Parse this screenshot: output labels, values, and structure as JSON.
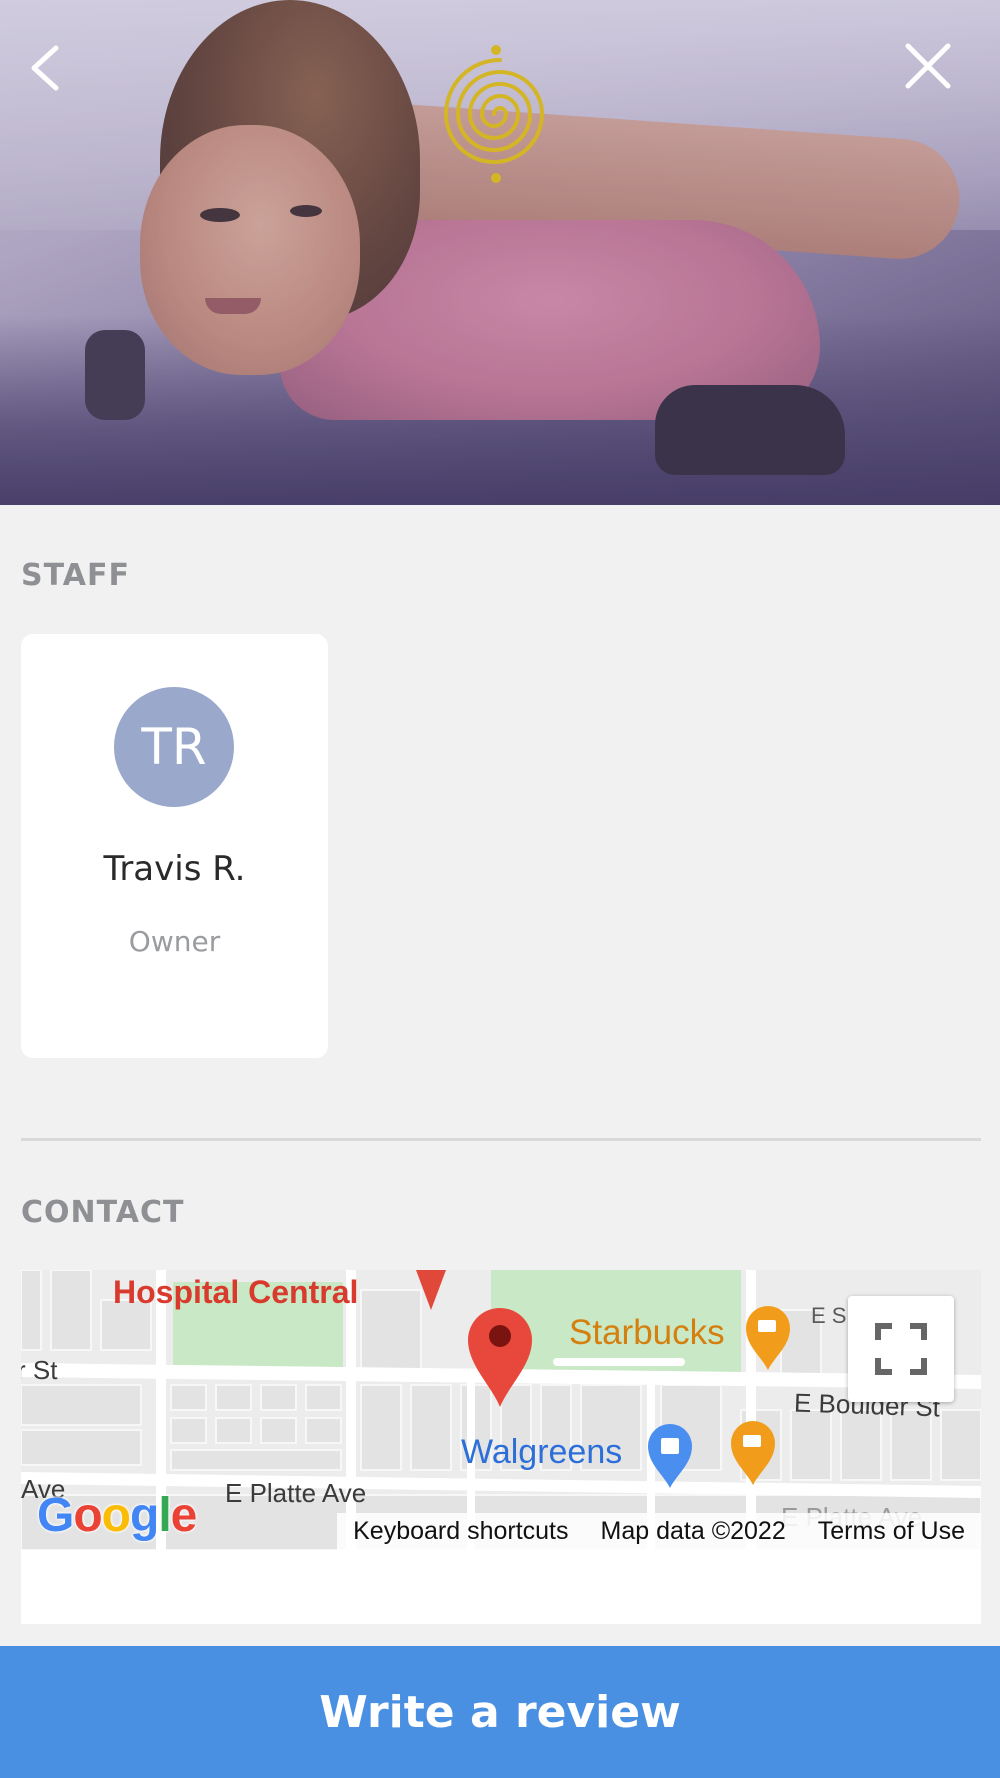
{
  "hero": {
    "back_icon": "chevron-left-icon",
    "close_icon": "close-icon",
    "logo_icon": "spiral-logo",
    "logo_color": "#d4b526"
  },
  "staff": {
    "section_title": "STAFF",
    "members": [
      {
        "initials": "TR",
        "name": "Travis R.",
        "role": "Owner",
        "avatar_color": "#9aa8cc"
      }
    ]
  },
  "contact": {
    "section_title": "CONTACT",
    "map": {
      "places": {
        "hospital": "Hospital Central",
        "starbucks": "Starbucks",
        "walgreens": "Walgreens"
      },
      "streets": {
        "left_st": "r St",
        "e_boulder": "E Boulder St",
        "e_platte": "E Platte Ave",
        "e_platte_right": "E Platte Ave",
        "ave_left": "Ave",
        "e_s": "E S"
      },
      "fullscreen_icon": "fullscreen-icon",
      "google_logo": "Google",
      "footer": {
        "shortcuts": "Keyboard shortcuts",
        "map_data": "Map data ©2022",
        "terms": "Terms of Use"
      }
    }
  },
  "actions": {
    "write_review": "Write a review",
    "button_color": "#4a90e2"
  }
}
